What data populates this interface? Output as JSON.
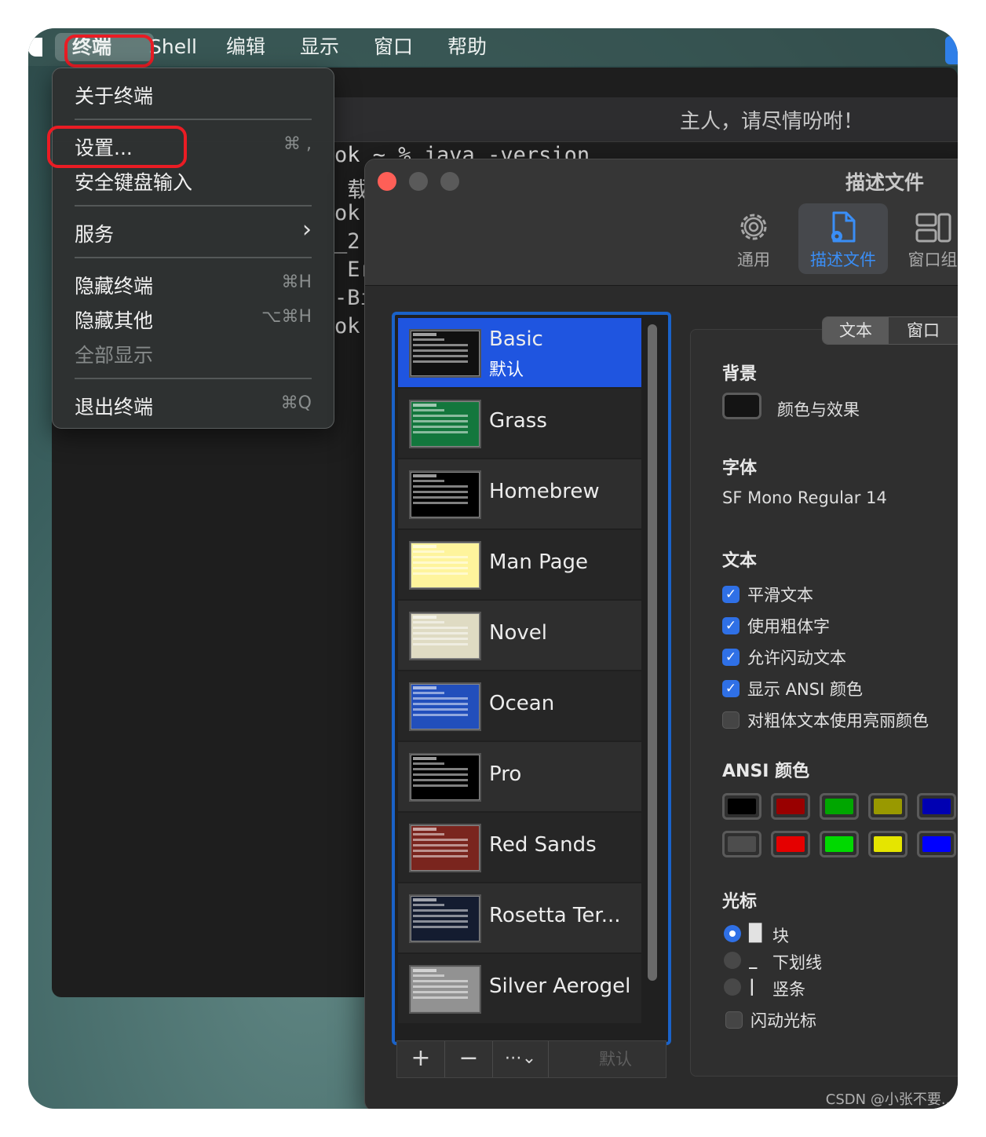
{
  "menubar": {
    "app_menu": "终端",
    "items": [
      "Shell",
      "编辑",
      "显示",
      "窗口",
      "帮助"
    ]
  },
  "terminal": {
    "title": "主人，请尽情吩咐！",
    "lines": [
      "ok ~ % java -version",
      " 载",
      "ok",
      "_2(",
      " Er",
      "-Bi",
      "ok"
    ]
  },
  "app_menu": {
    "items": [
      {
        "label": "关于终端",
        "shortcut": ""
      },
      {
        "label": "设置...",
        "shortcut": "⌘ ,"
      },
      {
        "label": "安全键盘输入",
        "shortcut": ""
      },
      {
        "label": "服务",
        "shortcut": "›"
      },
      {
        "label": "隐藏终端",
        "shortcut": "⌘H"
      },
      {
        "label": "隐藏其他",
        "shortcut": "⌥⌘H"
      },
      {
        "label": "全部显示",
        "shortcut": ""
      },
      {
        "label": "退出终端",
        "shortcut": "⌘Q"
      }
    ]
  },
  "prefs": {
    "title": "描述文件",
    "toolbar": [
      {
        "label": "通用",
        "icon": "gear-icon"
      },
      {
        "label": "描述文件",
        "icon": "profile-doc-icon"
      },
      {
        "label": "窗口组",
        "icon": "window-group-icon"
      }
    ],
    "profiles": [
      {
        "name": "Basic",
        "bg": "#101010",
        "sub": "默认"
      },
      {
        "name": "Grass",
        "bg": "#13773d",
        "sub": ""
      },
      {
        "name": "Homebrew",
        "bg": "#000000",
        "sub": ""
      },
      {
        "name": "Man Page",
        "bg": "#fef49c",
        "sub": ""
      },
      {
        "name": "Novel",
        "bg": "#dfdbc3",
        "sub": ""
      },
      {
        "name": "Ocean",
        "bg": "#224fbc",
        "sub": ""
      },
      {
        "name": "Pro",
        "bg": "#000000",
        "sub": ""
      },
      {
        "name": "Red Sands",
        "bg": "#7a251e",
        "sub": ""
      },
      {
        "name": "Rosetta Ter...",
        "bg": "#141c30",
        "sub": ""
      },
      {
        "name": "Silver Aerogel",
        "bg": "#929292",
        "sub": ""
      }
    ],
    "list_toolbar": {
      "add": "+",
      "remove": "−",
      "more": "⋯⌄",
      "default": "默认"
    },
    "tabs": [
      "文本",
      "窗口"
    ],
    "background": {
      "heading": "背景",
      "label": "颜色与效果"
    },
    "font": {
      "heading": "字体",
      "value": "SF Mono Regular 14"
    },
    "text": {
      "heading": "文本",
      "options": [
        {
          "label": "平滑文本",
          "checked": true
        },
        {
          "label": "使用粗体字",
          "checked": true
        },
        {
          "label": "允许闪动文本",
          "checked": true
        },
        {
          "label": "显示 ANSI 颜色",
          "checked": true
        },
        {
          "label": "对粗体文本使用亮丽颜色",
          "checked": false
        }
      ]
    },
    "ansi": {
      "heading": "ANSI 颜色",
      "normal": [
        "#000000",
        "#990000",
        "#00a600",
        "#999900",
        "#0000b2"
      ],
      "bright": [
        "#4d4d4d",
        "#e50000",
        "#00d900",
        "#e5e500",
        "#0000ff"
      ]
    },
    "cursor": {
      "heading": "光标",
      "options": [
        {
          "glyph": "█",
          "label": "块",
          "selected": true
        },
        {
          "glyph": "_",
          "label": "下划线",
          "selected": false
        },
        {
          "glyph": "|",
          "label": "竖条",
          "selected": false
        }
      ],
      "blink_label": "闪动光标"
    }
  },
  "watermark": "CSDN @小张不要..."
}
